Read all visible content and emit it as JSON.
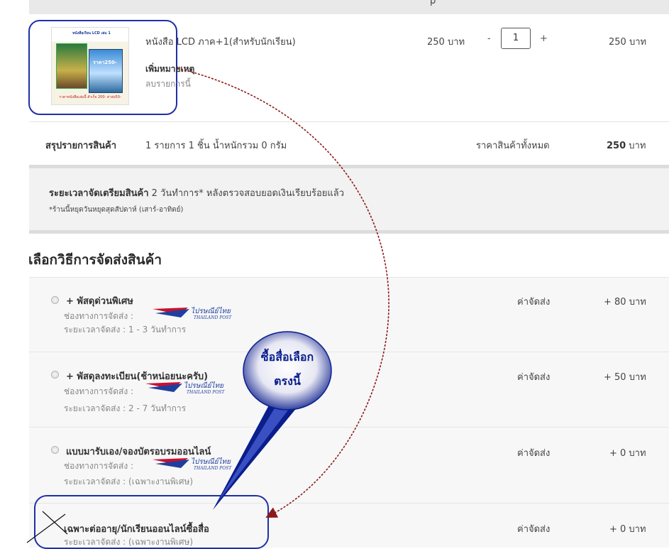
{
  "top_header": {
    "partial_char": "p"
  },
  "cart_item": {
    "thumb": {
      "title": "หนังสือเรียน LCD เล่ม 1",
      "price_badge": "ราคา250-",
      "footer": "ราคาหนังสือเล่มนี้ สำเร็จ 200- ค่าส่ง50-"
    },
    "name": "หนังสือ LCD ภาค+1(สำหรับนักเรียน)",
    "add_note": "เพิ่มหมายเหตุ",
    "remove": "ลบรายการนี้",
    "unit_price": "250 บาท",
    "qty_minus": "-",
    "qty": "1",
    "qty_plus": "+",
    "line_total": "250 บาท"
  },
  "summary": {
    "label": "สรุปรายการสินค้า",
    "detail": "1 รายการ 1 ชิ้น น้ำหนักรวม 0 กรัม",
    "total_label": "ราคาสินค้าทั้งหมด",
    "total_value": "250",
    "total_unit": "บาท"
  },
  "prep_time": {
    "label": "ระยะเวลาจัดเตรียมสินค้า",
    "value": "2 วันทำการ* หลังตรวจสอบยอดเงินเรียบร้อยแล้ว",
    "note": "*ร้านนี้หยุดวันหยุดสุดสัปดาห์ (เสาร์-อาทิตย์)"
  },
  "shipping": {
    "heading": "เลือกวิธีการจัดส่งสินค้า",
    "channel_label": "ช่องทางการจัดส่ง :",
    "time_label": "ระยะเวลาจัดส่ง :",
    "fee_label": "ค่าจัดส่ง",
    "carrier_logo_text": "ไปรษณีย์ไทย",
    "carrier_logo_sub": "THAILAND POST",
    "options": [
      {
        "name": "+ พัสดุด่วนพิเศษ",
        "time": "1 - 3 วันทำการ",
        "fee": "+ 80 บาท"
      },
      {
        "name": "+ พัสดุลงทะเบียน(ช้าหน่อยนะครับ)",
        "time": "2 - 7 วันทำการ",
        "fee": "+ 50 บาท"
      },
      {
        "name": "แบบมารับเอง/จองบัตรอบรมออนไลน์",
        "time": "(เฉพาะงานพิเศษ)",
        "fee": "+ 0 บาท"
      },
      {
        "name": "เฉพาะต่ออายุ/นักเรียนออนไลน์ซื้อสื่อ",
        "time": "(เฉพาะงานพิเศษ)",
        "fee": "+ 0 บาท"
      }
    ]
  },
  "annotation": {
    "callout_line1": "ซื้อสื่อเลือก",
    "callout_line2": "ตรงนี้",
    "callout_fill": "#0a1e8c",
    "outline_color": "#1f2fa8",
    "arrow_color": "#8b1a1a"
  }
}
